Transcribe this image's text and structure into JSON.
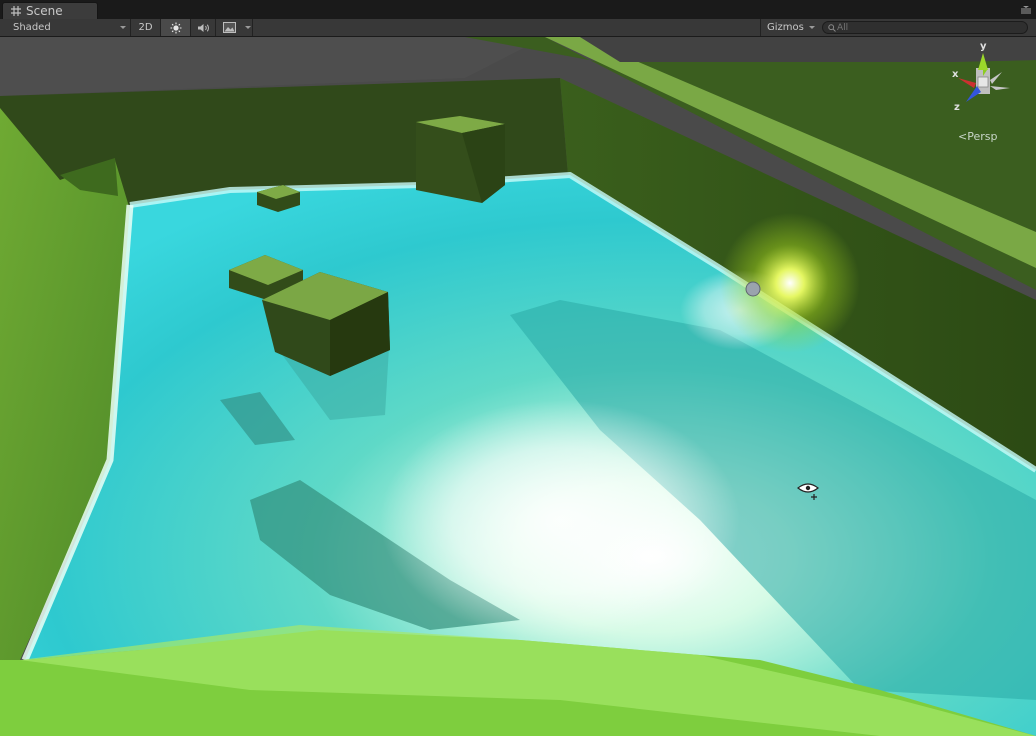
{
  "tab": {
    "title": "Scene",
    "icon": "scene-grid-icon"
  },
  "toolbar": {
    "render_mode": "Shaded",
    "mode_2d": "2D",
    "lighting_icon": "sun-icon",
    "audio_icon": "audio-icon",
    "effects_icon": "image-icon",
    "gizmos_label": "Gizmos",
    "search_placeholder": "All"
  },
  "gizmo": {
    "x": "x",
    "y": "y",
    "z": "z",
    "projection": "Persp"
  },
  "colors": {
    "background": "#2b2b2b",
    "toolbar": "#383838",
    "water": "#35d6d8",
    "ground": "#5e9a2c",
    "gizmo_x": "#cc3030",
    "gizmo_y": "#88cc22",
    "gizmo_z": "#3355dd"
  }
}
